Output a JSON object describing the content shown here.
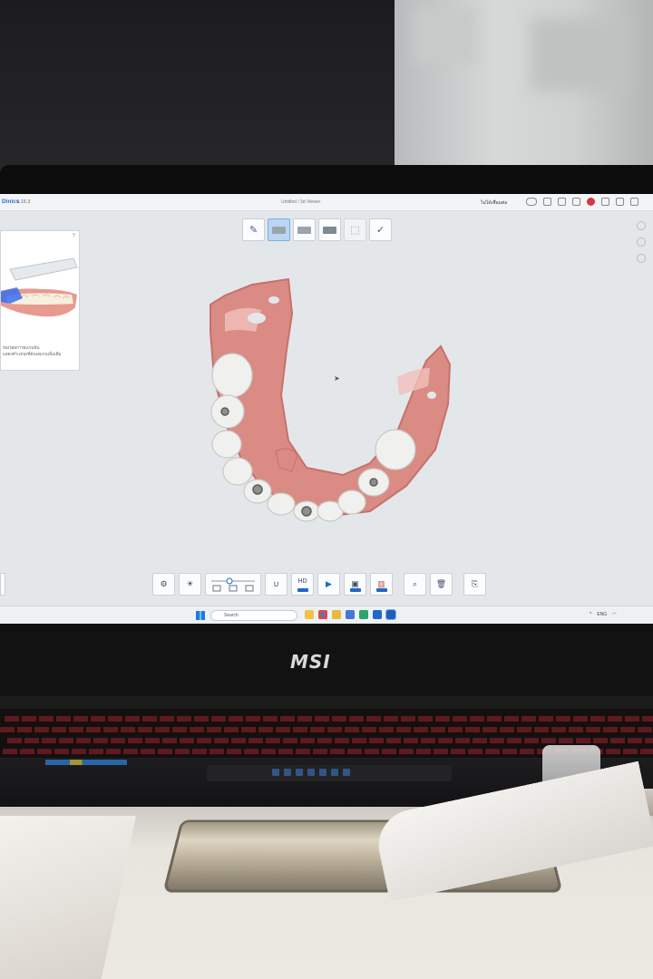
{
  "app": {
    "name": "Dinics",
    "version": "1.15.3",
    "window_title": "Untitled / 3d Viewer"
  },
  "titlebar": {
    "status_label": "ไม่ได้เชื่อมต่อ",
    "icons": [
      "toggle-icon",
      "help-icon",
      "settings-icon",
      "screenshot-icon",
      "record-icon",
      "minimize-icon",
      "maximize-icon",
      "close-icon"
    ]
  },
  "top_toolbar": {
    "steps": [
      "edit-icon",
      "upper-jaw-icon",
      "lower-jaw-icon",
      "bite-icon",
      "scan-region-icon",
      "confirm-icon"
    ],
    "active_index": 1
  },
  "left_panel": {
    "help": "?",
    "text_line1": "ร่องรอยการสแกนฟัน",
    "text_line2": "แสดงตำแหน่งที่ต้องสแกนเพิ่มเติม"
  },
  "bottom_toolbar": {
    "tools": [
      "scan-tip-icon",
      "light-icon",
      "speed-slider",
      "arch-icon",
      "hd-icon",
      "play-icon",
      "image-icon",
      "color-icon",
      "capture-icon",
      "trash-icon",
      "export-icon"
    ],
    "hd_label": "HD"
  },
  "taskbar": {
    "search_placeholder": "Search",
    "tray_text": "ENG"
  },
  "laptop": {
    "brand": "MSI"
  },
  "colors": {
    "accent": "#2a6fd6",
    "gum": "#d98b84",
    "teeth": "#f0f0ee"
  }
}
